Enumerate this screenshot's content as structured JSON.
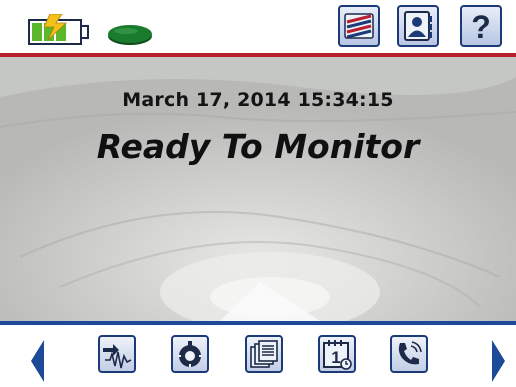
{
  "header": {
    "battery_icon": "battery-charging-icon",
    "status_icon": "status-indicator-icon",
    "buttons": [
      {
        "name": "event-log-button",
        "icon": "event-log-icon"
      },
      {
        "name": "contacts-button",
        "icon": "contact-card-icon"
      },
      {
        "name": "help-button",
        "icon": "help-icon",
        "label": "?"
      }
    ]
  },
  "main": {
    "datetime": "March 17, 2014 15:34:15",
    "status": "Ready To Monitor"
  },
  "footer": {
    "buttons": [
      {
        "name": "start-monitoring-button",
        "icon": "waveform-icon"
      },
      {
        "name": "settings-button",
        "icon": "dial-icon"
      },
      {
        "name": "reports-button",
        "icon": "documents-icon"
      },
      {
        "name": "calendar-button",
        "icon": "calendar-icon",
        "label": "1"
      },
      {
        "name": "call-button",
        "icon": "phone-icon"
      }
    ]
  },
  "colors": {
    "header_rule": "#b8202e",
    "footer_rule": "#1d4a98",
    "button_border": "#1d3a78",
    "battery_fill": "#5ab82a",
    "status_led": "#1a7a2e"
  }
}
